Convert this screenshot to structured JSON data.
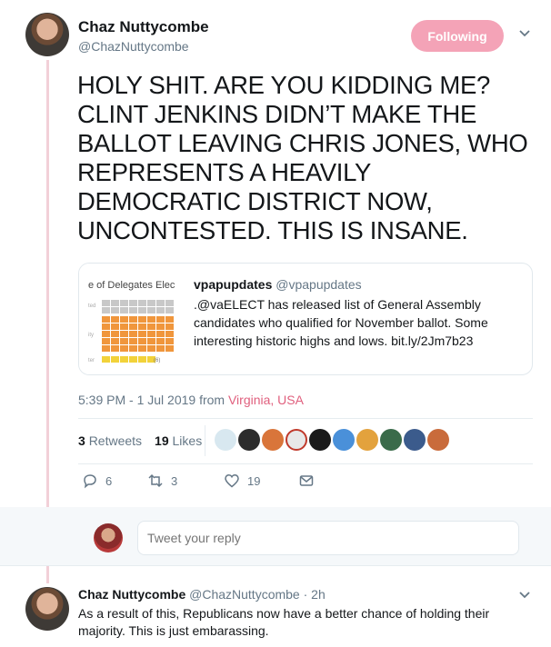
{
  "author": {
    "display_name": "Chaz Nuttycombe",
    "handle": "@ChazNuttycombe"
  },
  "follow_button": {
    "label": "Following",
    "color": "#f4a3b7"
  },
  "tweet": {
    "text": "HOLY SHIT. ARE YOU KIDDING ME? CLINT JENKINS DIDN’T MAKE THE BALLOT LEAVING CHRIS JONES, WHO REPRESENTS A HEAVILY DEMOCRATIC DISTRICT NOW, UNCONTESTED. THIS IS INSANE.",
    "time": "5:39 PM - 1 Jul 2019 from ",
    "location": "Virginia, USA"
  },
  "quoted": {
    "thumb_title": "e of Delegates Elec",
    "thumb_labels": [
      "ted",
      "ity",
      "ter"
    ],
    "thumb_count": "(6)",
    "author_name": "vpapupdates",
    "author_handle": "@vpapupdates",
    "text": ".@vaELECT has released list of General Assembly candidates who qualified for November ballot. Some interesting historic highs and lows. bit.ly/2Jm7b23"
  },
  "stats": {
    "retweets_count": "3",
    "retweets_label": "Retweets",
    "likes_count": "19",
    "likes_label": "Likes"
  },
  "actions": {
    "reply_count": "6",
    "retweet_count": "3",
    "like_count": "19"
  },
  "reply_box": {
    "placeholder": "Tweet your reply"
  },
  "reply_tweet": {
    "display_name": "Chaz Nuttycombe",
    "handle_time": "@ChazNuttycombe · 2h",
    "text": "As a result of this, Republicans now have a better chance of holding their majority. This is just embarassing."
  },
  "colors": {
    "accent": "#e0607e",
    "thread_line": "#f2d0d8",
    "muted": "#657786"
  }
}
